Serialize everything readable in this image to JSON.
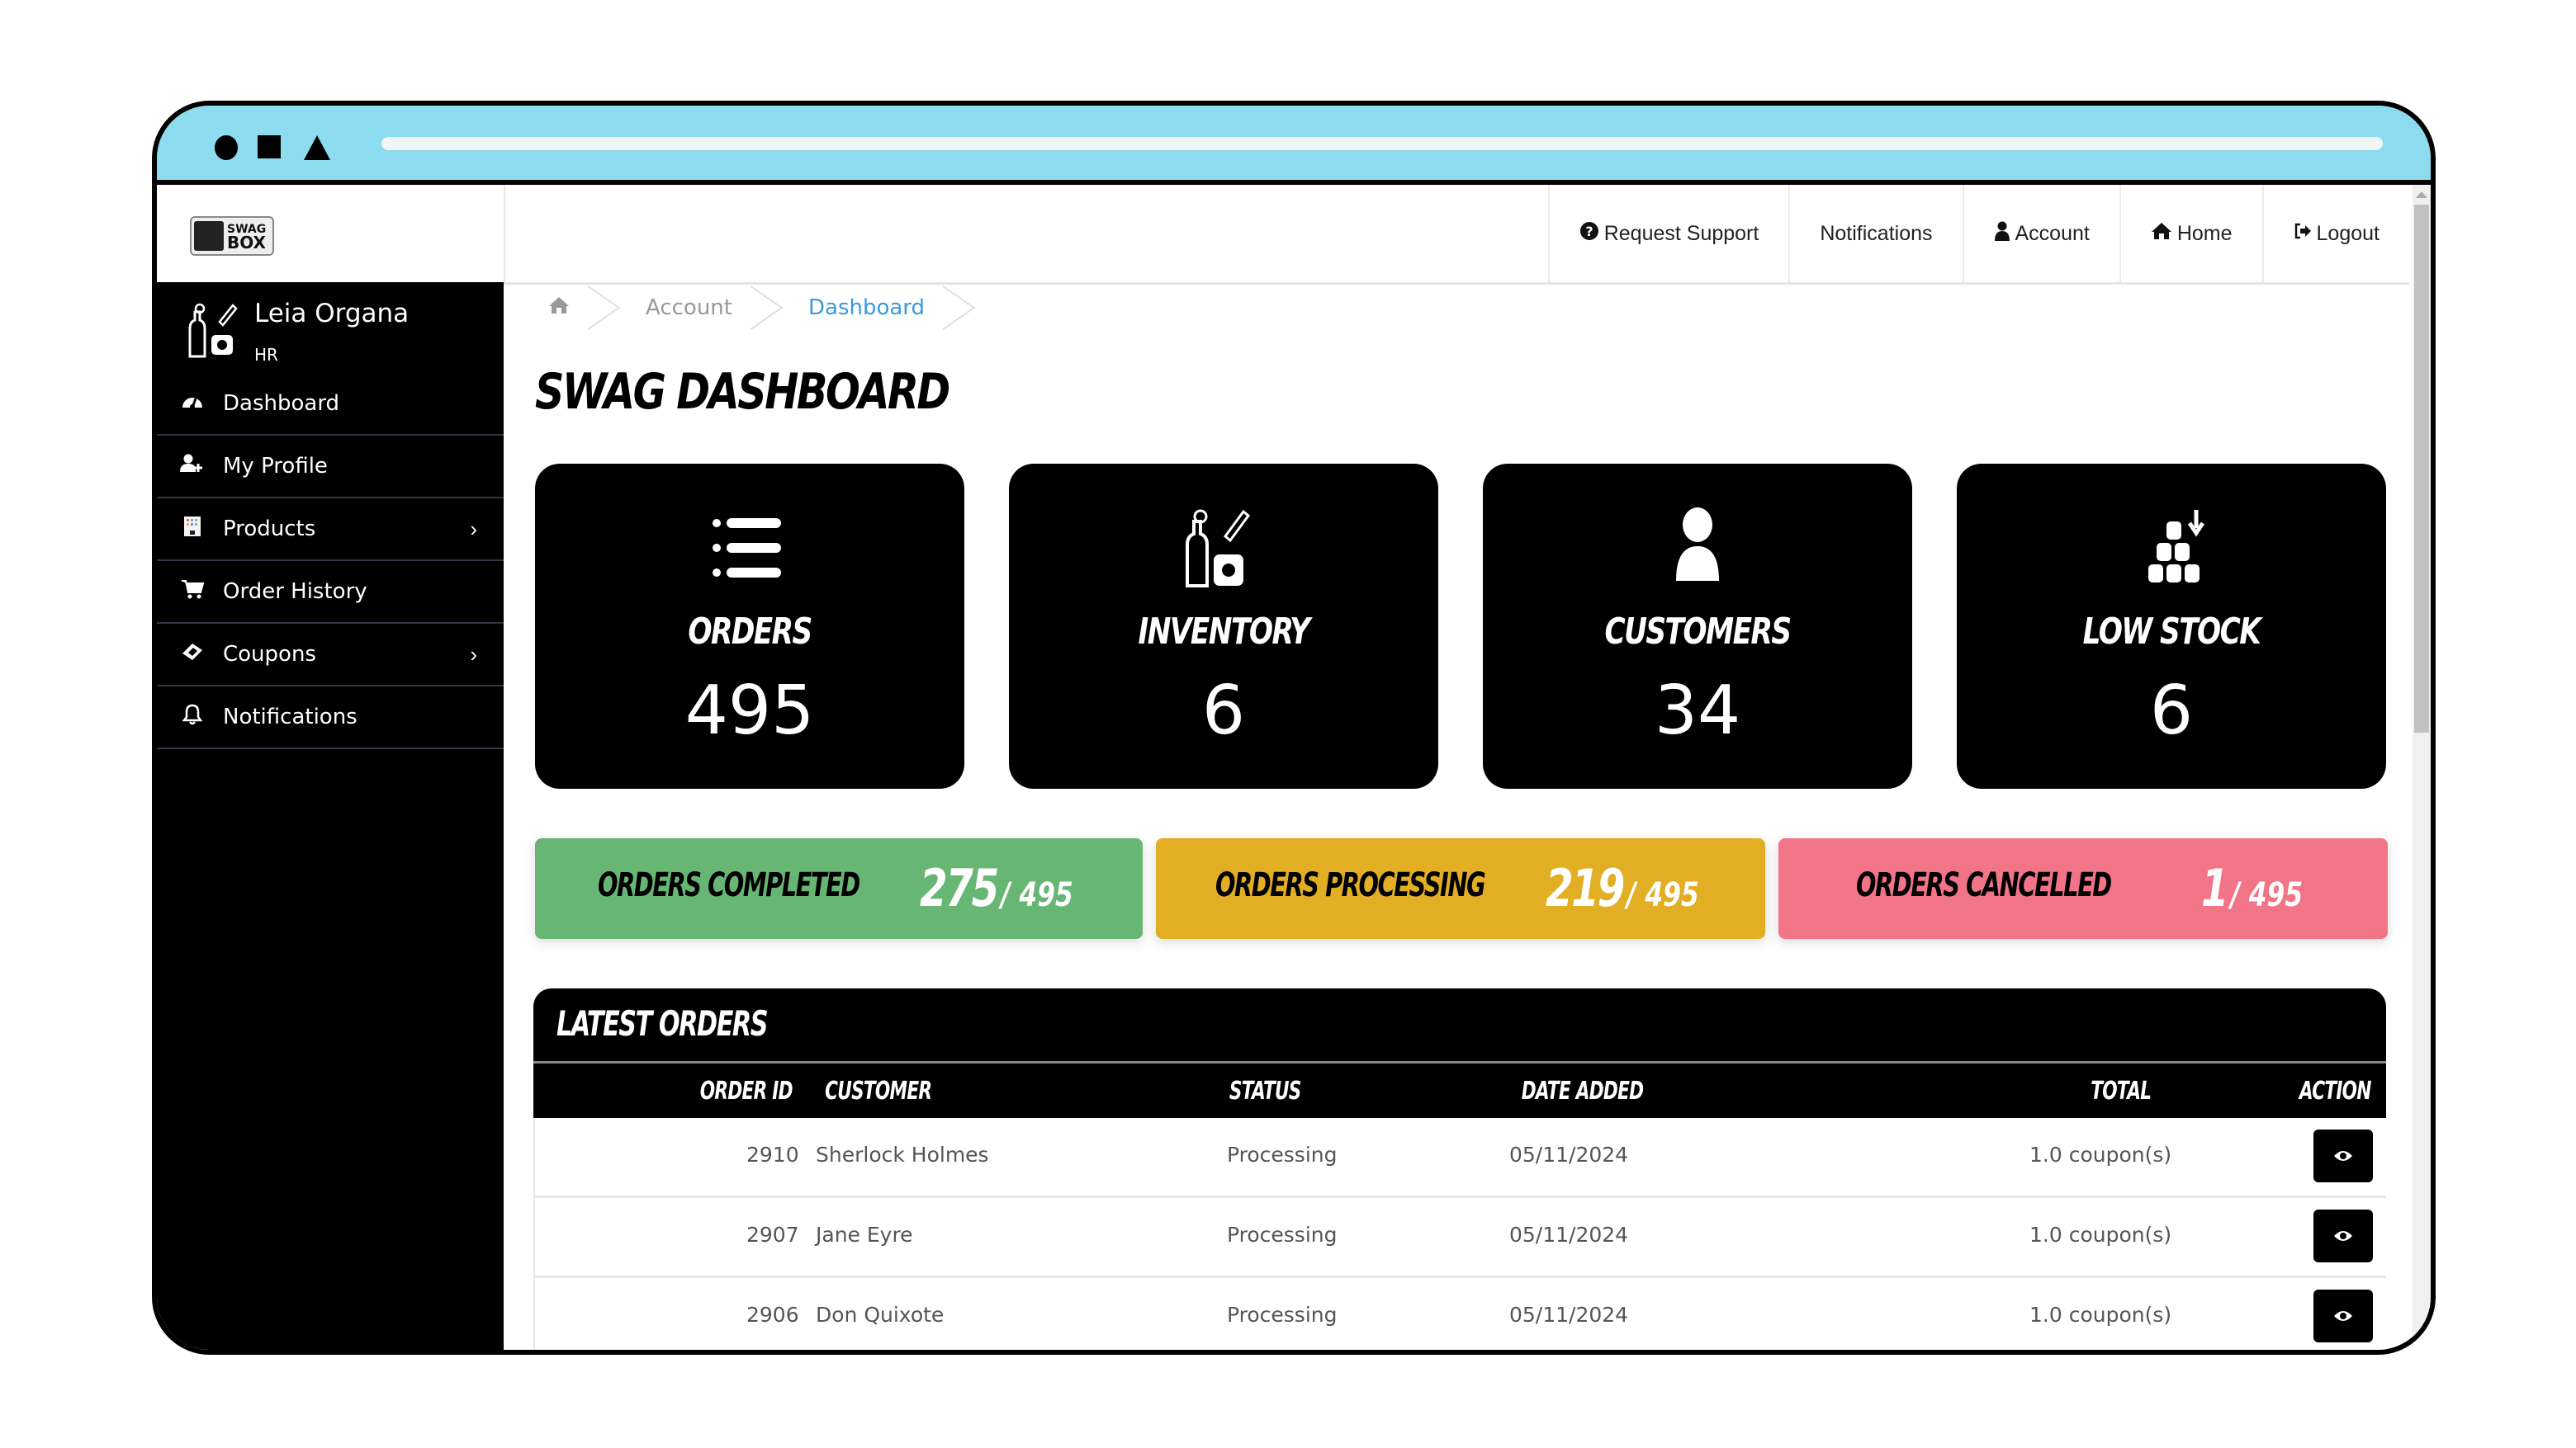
{
  "window": {
    "controls": [
      "circle",
      "square",
      "triangle"
    ]
  },
  "brand": {
    "logo_line1": "SWAG",
    "logo_line2": "BOX"
  },
  "topnav": {
    "links": [
      {
        "label": "Request Support",
        "icon": "question-circle-icon"
      },
      {
        "label": "Notifications",
        "icon": ""
      },
      {
        "label": "Account",
        "icon": "user-icon"
      },
      {
        "label": "Home",
        "icon": "home-icon"
      },
      {
        "label": "Logout",
        "icon": "sign-out-icon"
      }
    ]
  },
  "sidebar": {
    "user": {
      "name": "Leia Organa",
      "role": "HR"
    },
    "items": [
      {
        "label": "Dashboard",
        "icon": "dashboard-gauge-icon",
        "has_submenu": false
      },
      {
        "label": "My Profile",
        "icon": "user-plus-icon",
        "has_submenu": false
      },
      {
        "label": "Products",
        "icon": "products-icon",
        "has_submenu": true
      },
      {
        "label": "Order History",
        "icon": "cart-icon",
        "has_submenu": false
      },
      {
        "label": "Coupons",
        "icon": "ticket-icon",
        "has_submenu": true
      },
      {
        "label": "Notifications",
        "icon": "bell-icon",
        "has_submenu": false
      }
    ],
    "chevron": "›"
  },
  "breadcrumb": [
    {
      "label": "",
      "icon": "home-icon"
    },
    {
      "label": "Account"
    },
    {
      "label": "Dashboard",
      "active": true
    }
  ],
  "page": {
    "title": "SWAG DASHBOARD"
  },
  "stats": [
    {
      "label": "ORDERS",
      "value": "495",
      "icon": "list-icon"
    },
    {
      "label": "INVENTORY",
      "value": "6",
      "icon": "swag-items-icon"
    },
    {
      "label": "CUSTOMERS",
      "value": "34",
      "icon": "user-icon"
    },
    {
      "label": "LOW STOCK",
      "value": "6",
      "icon": "stock-down-icon"
    }
  ],
  "status": [
    {
      "label": "ORDERS COMPLETED",
      "count": "275",
      "total": "/ 495",
      "color": "#68b673"
    },
    {
      "label": "ORDERS PROCESSING",
      "count": "219",
      "total": "/ 495",
      "color": "#e2ae24"
    },
    {
      "label": "ORDERS CANCELLED",
      "count": "1",
      "total": "/ 495",
      "color": "#f27587"
    }
  ],
  "orders": {
    "title": "LATEST ORDERS",
    "columns": [
      "ORDER ID",
      "CUSTOMER",
      "STATUS",
      "DATE ADDED",
      "TOTAL",
      "ACTION"
    ],
    "rows": [
      {
        "id": "2910",
        "customer": "Sherlock Holmes",
        "status": "Processing",
        "date": "05/11/2024",
        "total": "1.0 coupon(s)"
      },
      {
        "id": "2907",
        "customer": "Jane Eyre",
        "status": "Processing",
        "date": "05/11/2024",
        "total": "1.0 coupon(s)"
      },
      {
        "id": "2906",
        "customer": "Don Quixote",
        "status": "Processing",
        "date": "05/11/2024",
        "total": "1.0 coupon(s)"
      }
    ]
  },
  "colors": {
    "chrome": "#8ddbee",
    "sidebar_bg": "#000000",
    "breadcrumb_active": "#3a9ad9"
  }
}
